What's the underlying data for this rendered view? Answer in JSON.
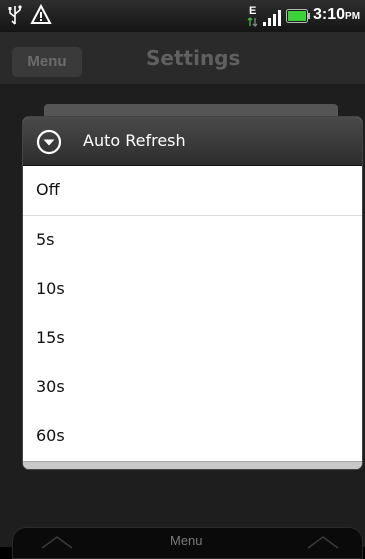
{
  "status_bar": {
    "time": "3:10",
    "ampm": "PM",
    "network_type": "E",
    "icons": [
      "usb-icon",
      "warning-icon",
      "edge-network-icon",
      "signal-icon",
      "battery-icon"
    ]
  },
  "title_bar": {
    "menu_label": "Menu",
    "title": "Settings"
  },
  "dialog": {
    "title": "Auto Refresh",
    "icon": "dropdown-circle-icon",
    "options": [
      {
        "label": "Off"
      },
      {
        "label": "5s"
      },
      {
        "label": "10s"
      },
      {
        "label": "15s"
      },
      {
        "label": "30s"
      },
      {
        "label": "60s"
      }
    ]
  },
  "bottom_bar": {
    "menu_label": "Menu"
  }
}
